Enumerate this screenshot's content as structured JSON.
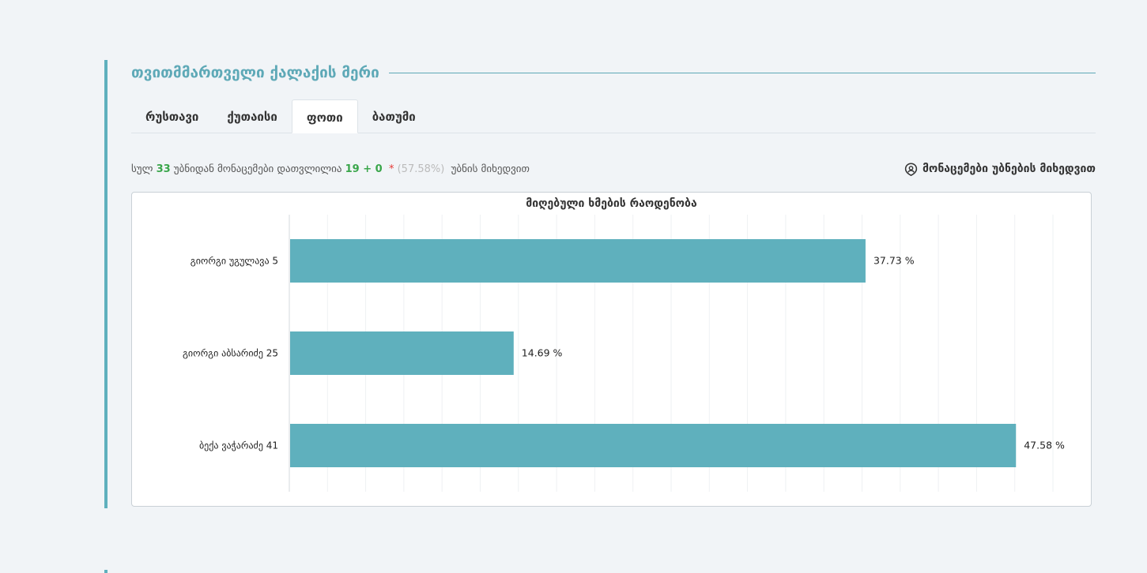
{
  "section": {
    "title": "თვითმმართველი ქალაქის მერი",
    "tabs": [
      {
        "label": "რუსთავი",
        "active": false
      },
      {
        "label": "ქუთაისი",
        "active": false
      },
      {
        "label": "ფოთი",
        "active": true
      },
      {
        "label": "ბათუმი",
        "active": false
      }
    ]
  },
  "info": {
    "prefix": "სულ",
    "total": "33",
    "middle": "უბნიდან მონაცემები დათვლილია",
    "counted": "19 + 0",
    "asterisk": "*",
    "percent": "(57.58%)",
    "suffix": "უბნის მიხედვით",
    "link_label": "მონაცემები უბნების მიხედვით",
    "link_icon": "user-location-icon"
  },
  "colors": {
    "bar": "#5fb0bd",
    "accent": "#5ea9b7",
    "green": "#3aa64b",
    "red": "#e53935"
  },
  "chart_data": {
    "type": "bar",
    "orientation": "horizontal",
    "title": "მიღებული ხმების რაოდენობა",
    "categories": [
      "გიორგი უგულავა 5",
      "გიორგი აბსარიძე 25",
      "ბექა ვაჭარაძე 41"
    ],
    "values": [
      37.73,
      14.69,
      47.58
    ],
    "value_labels": [
      "37.73 %",
      "14.69 %",
      "47.58 %"
    ],
    "xlim": [
      0,
      50
    ],
    "grid": true
  }
}
